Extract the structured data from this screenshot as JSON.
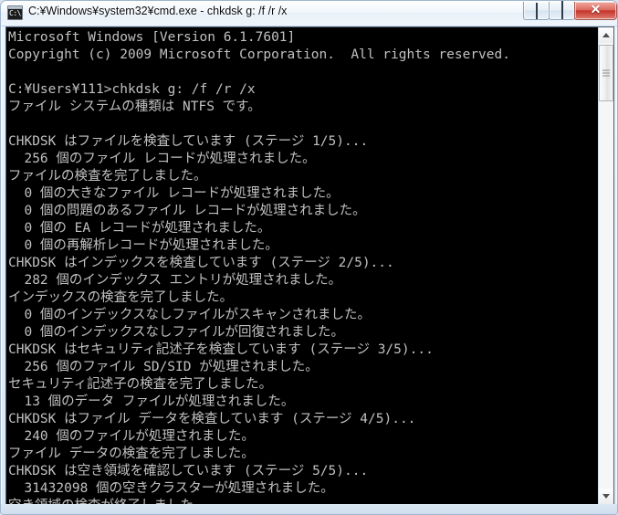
{
  "window": {
    "title": "C:¥Windows¥system32¥cmd.exe - chkdsk  g: /f /r /x",
    "icon_name": "cmd-console-icon",
    "icon_glyph": "C:\\.",
    "accent_close": "#c4342a",
    "frame_color": "#9fb6cd",
    "console_bg": "#000000",
    "console_fg": "#c0c0c0"
  },
  "caption_buttons": {
    "minimize_label": "Minimize",
    "maximize_label": "Maximize",
    "close_label": "✕"
  },
  "console": {
    "lines": [
      "Microsoft Windows [Version 6.1.7601]",
      "Copyright (c) 2009 Microsoft Corporation.  All rights reserved.",
      "",
      "C:¥Users¥111>chkdsk g: /f /r /x",
      "ファイル システムの種類は NTFS です。",
      "",
      "CHKDSK はファイルを検査しています (ステージ 1/5)...",
      "  256 個のファイル レコードが処理されました。",
      "ファイルの検査を完了しました。",
      "  0 個の大きなファイル レコードが処理されました。",
      "  0 個の問題のあるファイル レコードが処理されました。",
      "  0 個の EA レコードが処理されました。",
      "  0 個の再解析レコードが処理されました。",
      "CHKDSK はインデックスを検査しています (ステージ 2/5)...",
      "  282 個のインデックス エントリが処理されました。",
      "インデックスの検査を完了しました。",
      "  0 個のインデックスなしファイルがスキャンされました。",
      "  0 個のインデックスなしファイルが回復されました。",
      "CHKDSK はセキュリティ記述子を検査しています (ステージ 3/5)...",
      "  256 個のファイル SD/SID が処理されました。",
      "セキュリティ記述子の検査を完了しました。",
      "  13 個のデータ ファイルが処理されました。",
      "CHKDSK はファイル データを検査しています (ステージ 4/5)...",
      "  240 個のファイルが処理されました。",
      "ファイル データの検査を完了しました。",
      "CHKDSK は空き領域を確認しています (ステージ 5/5)...",
      "  31432098 個の空きクラスターが処理されました。",
      "空き領域の検査が終了しました。"
    ]
  },
  "scrollbar": {
    "up_arrow": "▲",
    "down_arrow": "▼"
  }
}
